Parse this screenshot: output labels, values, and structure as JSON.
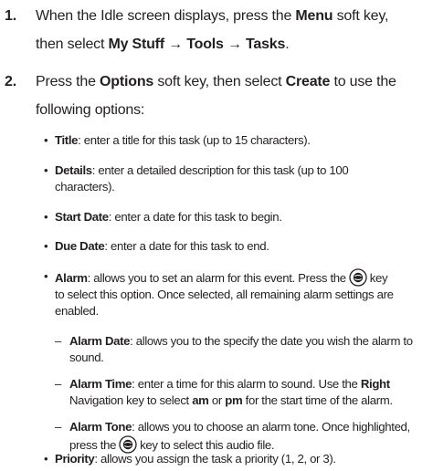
{
  "steps": [
    {
      "number": "1.",
      "line1_pre": "When the Idle screen displays, press the ",
      "line1_key": "Menu",
      "line1_post": " soft key,",
      "line2_pre": "then select ",
      "line2_path": "My Stuff → Tools → Tasks",
      "line2_post": "."
    },
    {
      "number": "2.",
      "line1_pre": "Press the ",
      "line1_key": "Options",
      "line1_mid": " soft key, then select ",
      "line1_key2": "Create",
      "line1_post": " to use the",
      "line2": "following options:"
    }
  ],
  "options": {
    "bullet_char": "•",
    "dash_char": "–",
    "title_label": "Title",
    "title_desc": ": enter a title for this task (up to 15 characters).",
    "details_label": "Details",
    "details_desc_1": ": enter a detailed description for this task (up to 100",
    "details_desc_2": "characters).",
    "start_label": "Start Date",
    "start_desc": ": enter a date for this task to begin.",
    "due_label": "Due Date",
    "due_desc": ": enter a date for this task to end.",
    "alarm_label": "Alarm",
    "alarm_desc_1a": ": allows you to set an alarm for this event. Press the",
    "alarm_desc_1b": "key",
    "alarm_desc_2": "to select this option. Once selected, all remaining alarm settings are",
    "alarm_desc_3": "enabled.",
    "alarm_date_label": "Alarm Date",
    "alarm_date_desc_1": ": allows you to the specify the date you wish the alarm to",
    "alarm_date_desc_2": "sound.",
    "alarm_time_label": "Alarm Time",
    "alarm_time_desc_1a": ": enter a time for this alarm to sound. Use the ",
    "alarm_time_right": "Right",
    "alarm_time_desc_2a": "Navigation key to select ",
    "alarm_time_am": "am",
    "alarm_time_or": " or ",
    "alarm_time_pm": "pm",
    "alarm_time_desc_2b": " for the start time of the alarm.",
    "alarm_tone_label": "Alarm Tone",
    "alarm_tone_desc_1": ": allows you to choose an alarm tone. Once highlighted,",
    "alarm_tone_desc_2a": "press the",
    "alarm_tone_desc_2b": "key to select this audio file.",
    "priority_label": "Priority",
    "priority_desc": ": allows you assign the task a priority (1, 2, or 3)."
  },
  "icons": {
    "ok_key": "center-select-key-icon"
  }
}
